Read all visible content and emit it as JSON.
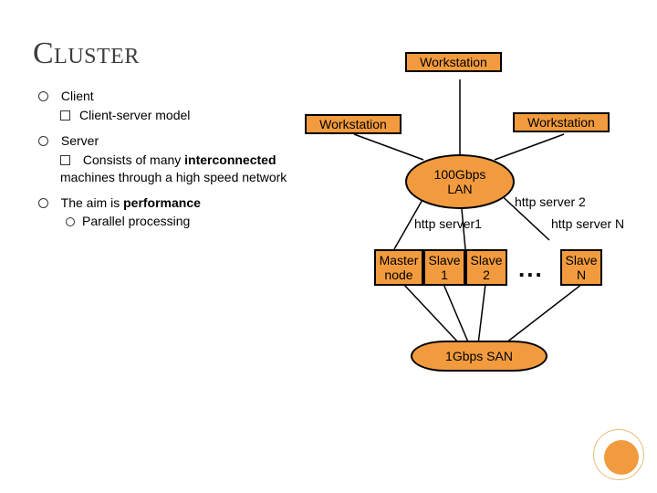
{
  "title": "Cluster",
  "bullets": {
    "client": "Client",
    "client_sub": "Client-server model",
    "server": "Server",
    "server_sub_pre": "Consists of many ",
    "server_sub_strong": "interconnected",
    "server_sub_post": " machines through a high speed network",
    "aim_pre": "The aim is ",
    "aim_strong": "performance",
    "aim_sub": "Parallel processing"
  },
  "diagram": {
    "ws_top": "Workstation",
    "ws_left": "Workstation",
    "ws_right": "Workstation",
    "lan": "100Gbps\nLAN",
    "http1": "http server1",
    "http2": "http server 2",
    "httpN": "http server N",
    "master": "Master\nnode",
    "slave1": "Slave\n1",
    "slave2": "Slave\n2",
    "slaveN": "Slave\nN",
    "dots": "...",
    "san": "1Gbps SAN"
  }
}
